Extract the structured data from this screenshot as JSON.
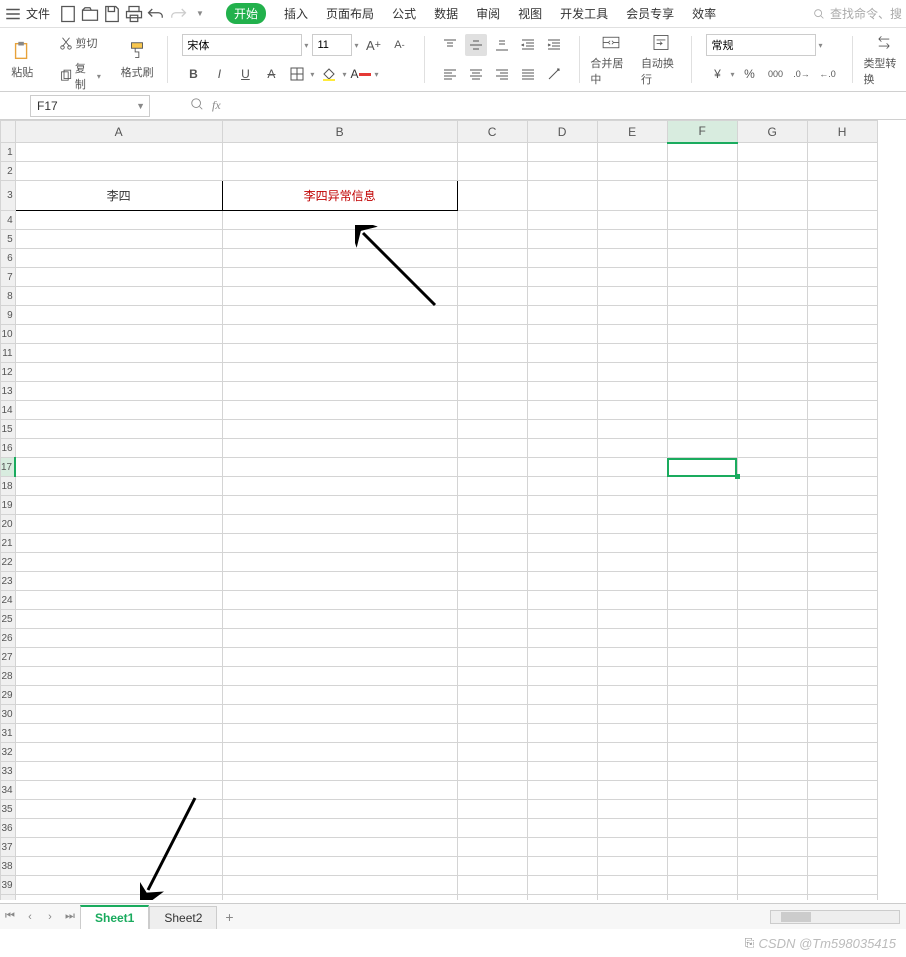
{
  "menu": {
    "file": "文件",
    "tabs": [
      "开始",
      "插入",
      "页面布局",
      "公式",
      "数据",
      "审阅",
      "视图",
      "开发工具",
      "会员专享",
      "效率"
    ],
    "active_tab": 0,
    "search_placeholder": "查找命令、搜"
  },
  "ribbon": {
    "paste": "粘贴",
    "cut": "剪切",
    "copy": "复制",
    "format_painter": "格式刷",
    "font_name": "宋体",
    "font_size": "11",
    "merge_center": "合并居中",
    "wrap_text": "自动换行",
    "number_format": "常规",
    "type_convert": "类型转换"
  },
  "namebox": "F17",
  "columns": [
    "A",
    "B",
    "C",
    "D",
    "E",
    "F",
    "G",
    "H"
  ],
  "active_column": "F",
  "active_row": 17,
  "cells": {
    "A3": "李四",
    "B3": "李四异常信息"
  },
  "sheet_tabs": [
    "Sheet1",
    "Sheet2"
  ],
  "active_sheet": 0,
  "watermark": "CSDN @Tm598035415"
}
